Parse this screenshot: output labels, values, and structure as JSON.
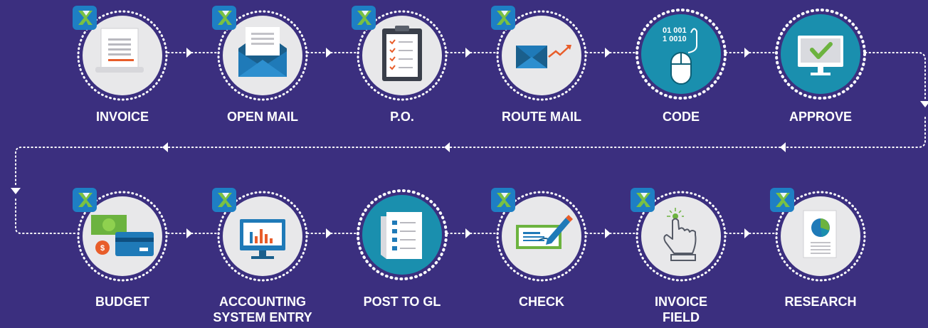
{
  "colors": {
    "background": "#3b2f7f",
    "circle_gray": "#e8e8ea",
    "circle_teal": "#1a8fae",
    "badge_blue": "#1e7fc4",
    "badge_green": "#7ac143",
    "accent_orange": "#e85d2a",
    "accent_green": "#6cb33f",
    "dotted_line": "#ffffff"
  },
  "steps_top": [
    {
      "label": "INVOICE",
      "icon": "invoice-document-icon",
      "badge": true,
      "style": "gray"
    },
    {
      "label": "OPEN MAIL",
      "icon": "open-envelope-icon",
      "badge": true,
      "style": "gray"
    },
    {
      "label": "P.O.",
      "icon": "clipboard-checklist-icon",
      "badge": true,
      "style": "gray"
    },
    {
      "label": "ROUTE MAIL",
      "icon": "envelope-arrow-icon",
      "badge": true,
      "style": "gray"
    },
    {
      "label": "CODE",
      "icon": "mouse-binary-icon",
      "badge": false,
      "style": "teal",
      "binary_line1": "01 001",
      "binary_line2": "1 0010"
    },
    {
      "label": "APPROVE",
      "icon": "monitor-check-icon",
      "badge": false,
      "style": "teal"
    }
  ],
  "steps_bottom": [
    {
      "label_line1": "BUDGET",
      "label_line2": "",
      "icon": "money-card-icon",
      "badge": true,
      "style": "gray"
    },
    {
      "label_line1": "ACCOUNTING",
      "label_line2": "SYSTEM ENTRY",
      "icon": "monitor-chart-icon",
      "badge": true,
      "style": "gray"
    },
    {
      "label_line1": "POST TO GL",
      "label_line2": "",
      "icon": "ledger-list-icon",
      "badge": false,
      "style": "teal"
    },
    {
      "label_line1": "CHECK",
      "label_line2": "",
      "icon": "check-pen-icon",
      "badge": true,
      "style": "gray"
    },
    {
      "label_line1": "INVOICE",
      "label_line2": "FIELD",
      "icon": "hand-touch-icon",
      "badge": true,
      "style": "gray"
    },
    {
      "label_line1": "RESEARCH",
      "label_line2": "",
      "icon": "report-piechart-icon",
      "badge": true,
      "style": "gray"
    }
  ]
}
